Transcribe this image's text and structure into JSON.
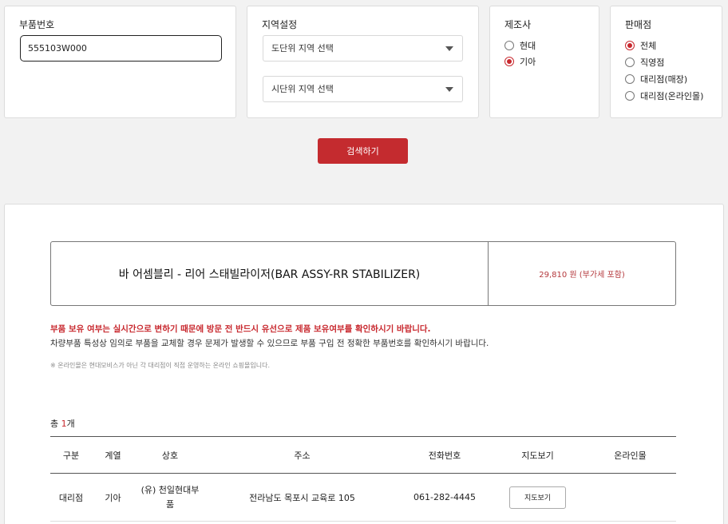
{
  "part_number": {
    "label": "부품번호",
    "value": "555103W000"
  },
  "region": {
    "label": "지역설정",
    "province_select": "도단위 지역 선택",
    "city_select": "시단위 지역 선택"
  },
  "maker": {
    "label": "제조사",
    "options": [
      {
        "label": "현대",
        "checked": false
      },
      {
        "label": "기아",
        "checked": true
      }
    ]
  },
  "store": {
    "label": "판매점",
    "options": [
      {
        "label": "전체",
        "checked": true
      },
      {
        "label": "직영점",
        "checked": false
      },
      {
        "label": "대리점(매장)",
        "checked": false
      },
      {
        "label": "대리점(온라인몰)",
        "checked": false
      }
    ]
  },
  "search_button": "검색하기",
  "product": {
    "name": "바 어셈블리 - 리어 스태빌라이저(BAR ASSY-RR STABILIZER)",
    "price": "29,810 원 (부가세 포함)"
  },
  "notice": {
    "red": "부품 보유 여부는 실시간으로 변하기 때문에 방문 전 반드시 유선으로 제품 보유여부를 확인하시기 바랍니다.",
    "dark": "차량부품 특성상 임의로 부품을 교체할 경우 문제가 발생할 수 있으므로 부품 구입 전 정확한 부품번호를 확인하시기 바랍니다.",
    "small": "※ 온라인몰은 현대모비스가 아닌 각 대리점이 직접 운영하는 온라인 쇼핑몰입니다."
  },
  "total": {
    "prefix": "총 ",
    "count": "1",
    "suffix": "개"
  },
  "table": {
    "headers": [
      "구분",
      "계열",
      "상호",
      "주소",
      "전화번호",
      "지도보기",
      "온라인몰"
    ],
    "rows": [
      {
        "type": "대리점",
        "brand": "기아",
        "name_line1": "(유) 천일현대부",
        "name_line2": "품",
        "address": "전라남도 목포시 교육로 105",
        "phone": "061-282-4445",
        "map_button": "지도보기",
        "online": ""
      }
    ]
  },
  "colors": {
    "accent": "#c42b2f",
    "price": "#b4383c"
  }
}
